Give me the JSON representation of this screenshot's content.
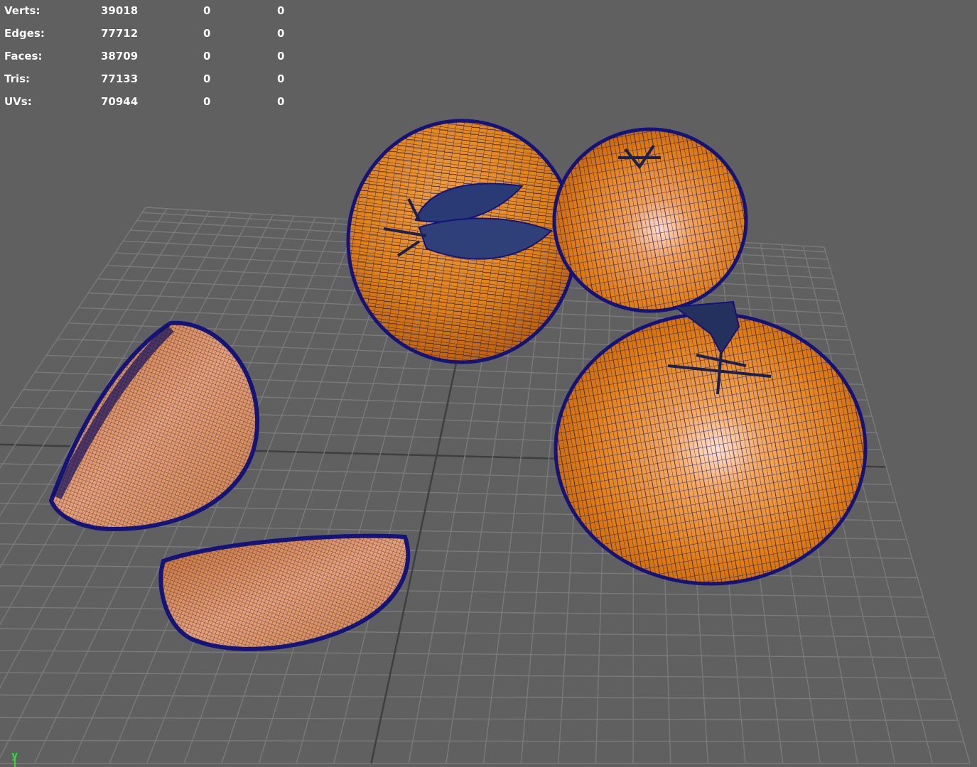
{
  "hud": {
    "rows": [
      {
        "label": "Verts:",
        "total": "39018",
        "selected": "0",
        "component": "0"
      },
      {
        "label": "Edges:",
        "total": "77712",
        "selected": "0",
        "component": "0"
      },
      {
        "label": "Faces:",
        "total": "38709",
        "selected": "0",
        "component": "0"
      },
      {
        "label": "Tris:",
        "total": "77133",
        "selected": "0",
        "component": "0"
      },
      {
        "label": "UVs:",
        "total": "70944",
        "selected": "0",
        "component": "0"
      }
    ]
  },
  "axis": {
    "up_label": "y"
  },
  "colors": {
    "background": "#606060",
    "grid": "#7a7a7a",
    "grid_axis": "#3f3f3f",
    "wireframe": "#1a1a7a",
    "fruit_base": "#e07a10",
    "fruit_light": "#ffd0b0",
    "axis_y": "#2bdc3a"
  },
  "scene": {
    "objects": [
      {
        "name": "mandarin-with-leaves",
        "kind": "whole-fruit"
      },
      {
        "name": "mandarin-back-right",
        "kind": "whole-fruit"
      },
      {
        "name": "mandarin-front-right",
        "kind": "whole-fruit"
      },
      {
        "name": "segment-left",
        "kind": "segment"
      },
      {
        "name": "segment-bottom",
        "kind": "segment"
      }
    ]
  }
}
